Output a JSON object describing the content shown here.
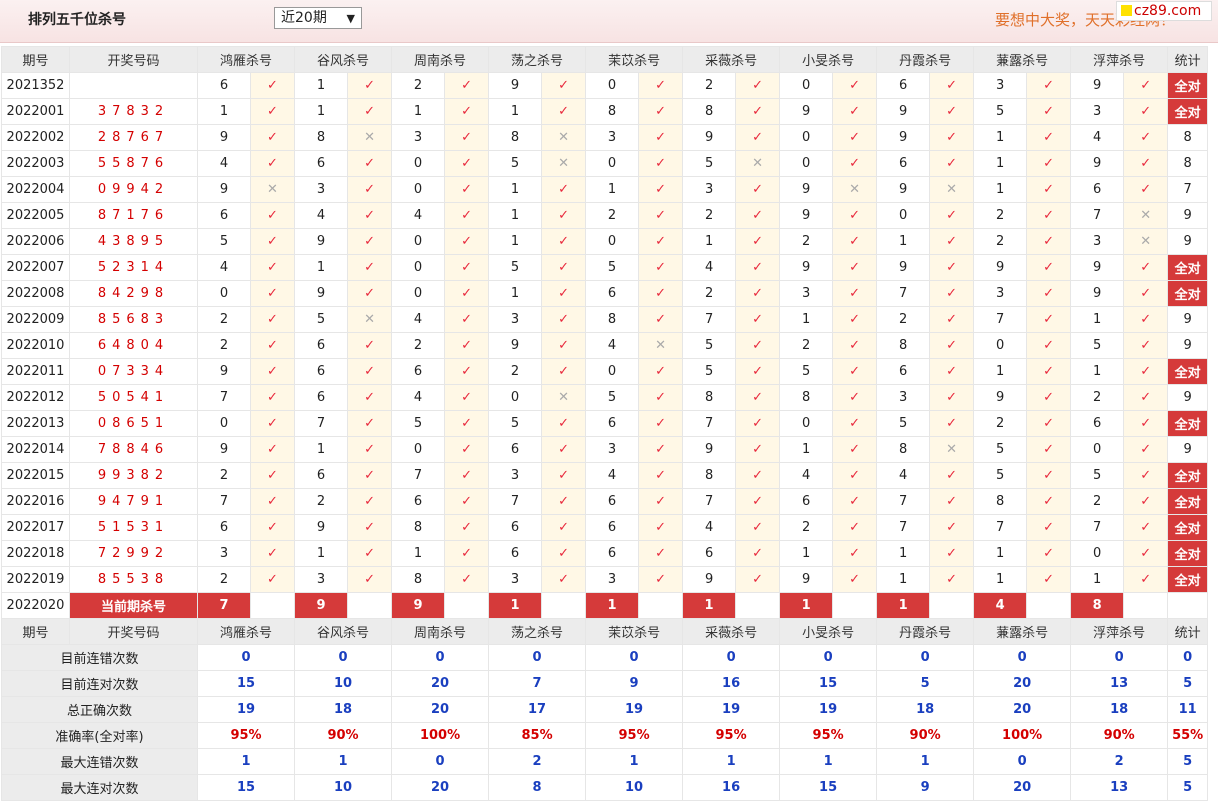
{
  "page": {
    "title": "排列五千位杀号",
    "period_select": "近20期",
    "marquee": "要想中大奖，天天彩经网！",
    "logo": "cz89.com"
  },
  "columns": [
    "期号",
    "开奖号码",
    "鸿雁杀号",
    "谷风杀号",
    "周南杀号",
    "荡之杀号",
    "茉苡杀号",
    "采薇杀号",
    "小旻杀号",
    "丹霞杀号",
    "蒹露杀号",
    "浮萍杀号",
    "统计"
  ],
  "rows": [
    {
      "issue": "2021352",
      "draw": "",
      "kills": [
        "6",
        "1",
        "2",
        "9",
        "0",
        "2",
        "0",
        "6",
        "3",
        "9"
      ],
      "marks": [
        "o",
        "o",
        "o",
        "o",
        "o",
        "o",
        "o",
        "o",
        "o",
        "o"
      ],
      "stat": "全对"
    },
    {
      "issue": "2022001",
      "draw": "37832",
      "kills": [
        "1",
        "1",
        "1",
        "1",
        "8",
        "8",
        "9",
        "9",
        "5",
        "3"
      ],
      "marks": [
        "o",
        "o",
        "o",
        "o",
        "o",
        "o",
        "o",
        "o",
        "o",
        "o"
      ],
      "stat": "全对"
    },
    {
      "issue": "2022002",
      "draw": "28767",
      "kills": [
        "9",
        "8",
        "3",
        "8",
        "3",
        "9",
        "0",
        "9",
        "1",
        "4"
      ],
      "marks": [
        "o",
        "x",
        "o",
        "x",
        "o",
        "o",
        "o",
        "o",
        "o",
        "o"
      ],
      "stat": "8"
    },
    {
      "issue": "2022003",
      "draw": "55876",
      "kills": [
        "4",
        "6",
        "0",
        "5",
        "0",
        "5",
        "0",
        "6",
        "1",
        "9"
      ],
      "marks": [
        "o",
        "o",
        "o",
        "x",
        "o",
        "x",
        "o",
        "o",
        "o",
        "o"
      ],
      "stat": "8"
    },
    {
      "issue": "2022004",
      "draw": "09942",
      "kills": [
        "9",
        "3",
        "0",
        "1",
        "1",
        "3",
        "9",
        "9",
        "1",
        "6"
      ],
      "marks": [
        "x",
        "o",
        "o",
        "o",
        "o",
        "o",
        "x",
        "x",
        "o",
        "o"
      ],
      "stat": "7"
    },
    {
      "issue": "2022005",
      "draw": "87176",
      "kills": [
        "6",
        "4",
        "4",
        "1",
        "2",
        "2",
        "9",
        "0",
        "2",
        "7"
      ],
      "marks": [
        "o",
        "o",
        "o",
        "o",
        "o",
        "o",
        "o",
        "o",
        "o",
        "x"
      ],
      "stat": "9"
    },
    {
      "issue": "2022006",
      "draw": "43895",
      "kills": [
        "5",
        "9",
        "0",
        "1",
        "0",
        "1",
        "2",
        "1",
        "2",
        "3"
      ],
      "marks": [
        "o",
        "o",
        "o",
        "o",
        "o",
        "o",
        "o",
        "o",
        "o",
        "x"
      ],
      "stat": "9"
    },
    {
      "issue": "2022007",
      "draw": "52314",
      "kills": [
        "4",
        "1",
        "0",
        "5",
        "5",
        "4",
        "9",
        "9",
        "9",
        "9"
      ],
      "marks": [
        "o",
        "o",
        "o",
        "o",
        "o",
        "o",
        "o",
        "o",
        "o",
        "o"
      ],
      "stat": "全对"
    },
    {
      "issue": "2022008",
      "draw": "84298",
      "kills": [
        "0",
        "9",
        "0",
        "1",
        "6",
        "2",
        "3",
        "7",
        "3",
        "9"
      ],
      "marks": [
        "o",
        "o",
        "o",
        "o",
        "o",
        "o",
        "o",
        "o",
        "o",
        "o"
      ],
      "stat": "全对"
    },
    {
      "issue": "2022009",
      "draw": "85683",
      "kills": [
        "2",
        "5",
        "4",
        "3",
        "8",
        "7",
        "1",
        "2",
        "7",
        "1"
      ],
      "marks": [
        "o",
        "x",
        "o",
        "o",
        "o",
        "o",
        "o",
        "o",
        "o",
        "o"
      ],
      "stat": "9"
    },
    {
      "issue": "2022010",
      "draw": "64804",
      "kills": [
        "2",
        "6",
        "2",
        "9",
        "4",
        "5",
        "2",
        "8",
        "0",
        "5"
      ],
      "marks": [
        "o",
        "o",
        "o",
        "o",
        "x",
        "o",
        "o",
        "o",
        "o",
        "o"
      ],
      "stat": "9"
    },
    {
      "issue": "2022011",
      "draw": "07334",
      "kills": [
        "9",
        "6",
        "6",
        "2",
        "0",
        "5",
        "5",
        "6",
        "1",
        "1"
      ],
      "marks": [
        "o",
        "o",
        "o",
        "o",
        "o",
        "o",
        "o",
        "o",
        "o",
        "o"
      ],
      "stat": "全对"
    },
    {
      "issue": "2022012",
      "draw": "50541",
      "kills": [
        "7",
        "6",
        "4",
        "0",
        "5",
        "8",
        "8",
        "3",
        "9",
        "2"
      ],
      "marks": [
        "o",
        "o",
        "o",
        "x",
        "o",
        "o",
        "o",
        "o",
        "o",
        "o"
      ],
      "stat": "9"
    },
    {
      "issue": "2022013",
      "draw": "08651",
      "kills": [
        "0",
        "7",
        "5",
        "5",
        "6",
        "7",
        "0",
        "5",
        "2",
        "6"
      ],
      "marks": [
        "o",
        "o",
        "o",
        "o",
        "o",
        "o",
        "o",
        "o",
        "o",
        "o"
      ],
      "stat": "全对"
    },
    {
      "issue": "2022014",
      "draw": "78846",
      "kills": [
        "9",
        "1",
        "0",
        "6",
        "3",
        "9",
        "1",
        "8",
        "5",
        "0"
      ],
      "marks": [
        "o",
        "o",
        "o",
        "o",
        "o",
        "o",
        "o",
        "x",
        "o",
        "o"
      ],
      "stat": "9"
    },
    {
      "issue": "2022015",
      "draw": "99382",
      "kills": [
        "2",
        "6",
        "7",
        "3",
        "4",
        "8",
        "4",
        "4",
        "5",
        "5"
      ],
      "marks": [
        "o",
        "o",
        "o",
        "o",
        "o",
        "o",
        "o",
        "o",
        "o",
        "o"
      ],
      "stat": "全对"
    },
    {
      "issue": "2022016",
      "draw": "94791",
      "kills": [
        "7",
        "2",
        "6",
        "7",
        "6",
        "7",
        "6",
        "7",
        "8",
        "2"
      ],
      "marks": [
        "o",
        "o",
        "o",
        "o",
        "o",
        "o",
        "o",
        "o",
        "o",
        "o"
      ],
      "stat": "全对"
    },
    {
      "issue": "2022017",
      "draw": "51531",
      "kills": [
        "6",
        "9",
        "8",
        "6",
        "6",
        "4",
        "2",
        "7",
        "7",
        "7"
      ],
      "marks": [
        "o",
        "o",
        "o",
        "o",
        "o",
        "o",
        "o",
        "o",
        "o",
        "o"
      ],
      "stat": "全对"
    },
    {
      "issue": "2022018",
      "draw": "72992",
      "kills": [
        "3",
        "1",
        "1",
        "6",
        "6",
        "6",
        "1",
        "1",
        "1",
        "0"
      ],
      "marks": [
        "o",
        "o",
        "o",
        "o",
        "o",
        "o",
        "o",
        "o",
        "o",
        "o"
      ],
      "stat": "全对"
    },
    {
      "issue": "2022019",
      "draw": "85538",
      "kills": [
        "2",
        "3",
        "8",
        "3",
        "3",
        "9",
        "9",
        "1",
        "1",
        "1"
      ],
      "marks": [
        "o",
        "o",
        "o",
        "o",
        "o",
        "o",
        "o",
        "o",
        "o",
        "o"
      ],
      "stat": "全对"
    }
  ],
  "current": {
    "issue": "2022020",
    "label": "当前期杀号",
    "kills": [
      "7",
      "9",
      "9",
      "1",
      "1",
      "1",
      "1",
      "1",
      "4",
      "8"
    ]
  },
  "stats": [
    {
      "label": "目前连错次数",
      "values": [
        "0",
        "0",
        "0",
        "0",
        "0",
        "0",
        "0",
        "0",
        "0",
        "0"
      ],
      "total": "0",
      "kind": "n"
    },
    {
      "label": "目前连对次数",
      "values": [
        "15",
        "10",
        "20",
        "7",
        "9",
        "16",
        "15",
        "5",
        "20",
        "13"
      ],
      "total": "5",
      "kind": "n"
    },
    {
      "label": "总正确次数",
      "values": [
        "19",
        "18",
        "20",
        "17",
        "19",
        "19",
        "19",
        "18",
        "20",
        "18"
      ],
      "total": "11",
      "kind": "n"
    },
    {
      "label": "准确率(全对率)",
      "values": [
        "95%",
        "90%",
        "100%",
        "85%",
        "95%",
        "95%",
        "95%",
        "90%",
        "100%",
        "90%"
      ],
      "total": "55%",
      "kind": "p"
    },
    {
      "label": "最大连错次数",
      "values": [
        "1",
        "1",
        "0",
        "2",
        "1",
        "1",
        "1",
        "1",
        "0",
        "2"
      ],
      "total": "5",
      "kind": "n"
    },
    {
      "label": "最大连对次数",
      "values": [
        "15",
        "10",
        "20",
        "8",
        "10",
        "16",
        "15",
        "9",
        "20",
        "13"
      ],
      "total": "5",
      "kind": "n"
    }
  ],
  "icons": {
    "correct": "check-mark-icon",
    "wrong": "cross-mark-icon"
  },
  "colors": {
    "accent_red": "#d53a3a",
    "draw_red": "#d40000",
    "stat_blue": "#1a3fbf",
    "check_red": "#e8283c",
    "marquee_orange": "#e0702a"
  }
}
